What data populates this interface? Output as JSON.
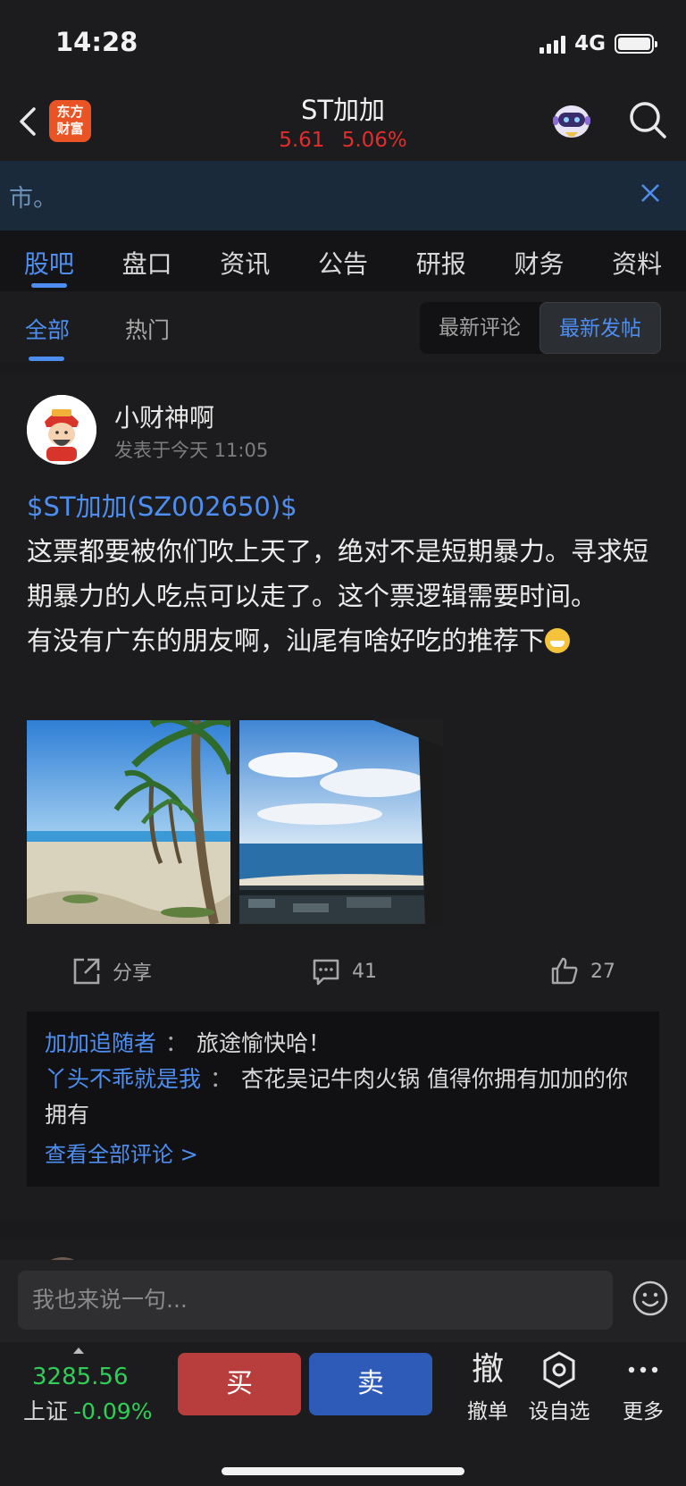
{
  "status_bar": {
    "time": "14:28",
    "network": "4G"
  },
  "header": {
    "logo_text": "东方财富",
    "title": "ST加加",
    "price": "5.61",
    "change_pct": "5.06%",
    "quote_color": "#e22d2d"
  },
  "banner": {
    "text": "市。"
  },
  "main_tabs": [
    {
      "label": "股吧"
    },
    {
      "label": "盘口"
    },
    {
      "label": "资讯"
    },
    {
      "label": "公告"
    },
    {
      "label": "研报"
    },
    {
      "label": "财务"
    },
    {
      "label": "资料"
    }
  ],
  "sub_tabs": {
    "all": "全部",
    "hot": "热门"
  },
  "sort": {
    "latest_comment": "最新评论",
    "latest_post": "最新发帖"
  },
  "post": {
    "author": "小财神啊",
    "time": "发表于今天 11:05",
    "stock_tag": "$ST加加(SZ002650)$",
    "text": "这票都要被你们吹上天了，绝对不是短期暴力。寻求短期暴力的人吃点可以走了。这个票逻辑需要时间。\n有没有广东的朋友啊，汕尾有啥好吃的推荐下",
    "actions": {
      "share": "分享",
      "comments": "41",
      "likes": "27"
    },
    "comments": [
      {
        "user": "加加追随者",
        "sep": "：",
        "text": "旅途愉快哈！"
      },
      {
        "user": "丫头不乖就是我",
        "sep": "：",
        "text": "杏花吴记牛肉火锅 值得你拥有加加的你拥有"
      }
    ],
    "view_all": "查看全部评论 >"
  },
  "input": {
    "placeholder": "我也来说一句..."
  },
  "trade_bar": {
    "index_value": "3285.56",
    "index_name": "上证",
    "index_change": "-0.09%",
    "buy": "买",
    "sell": "卖",
    "cancel_glyph": "撤",
    "cancel_label": "撤单",
    "watch_label": "设自选",
    "more_label": "更多"
  },
  "colors": {
    "accent": "#4d8ef0",
    "up_red": "#e22d2d",
    "down_green": "#2fcf57",
    "buy": "#b83d3d",
    "sell": "#2e5bb8"
  }
}
